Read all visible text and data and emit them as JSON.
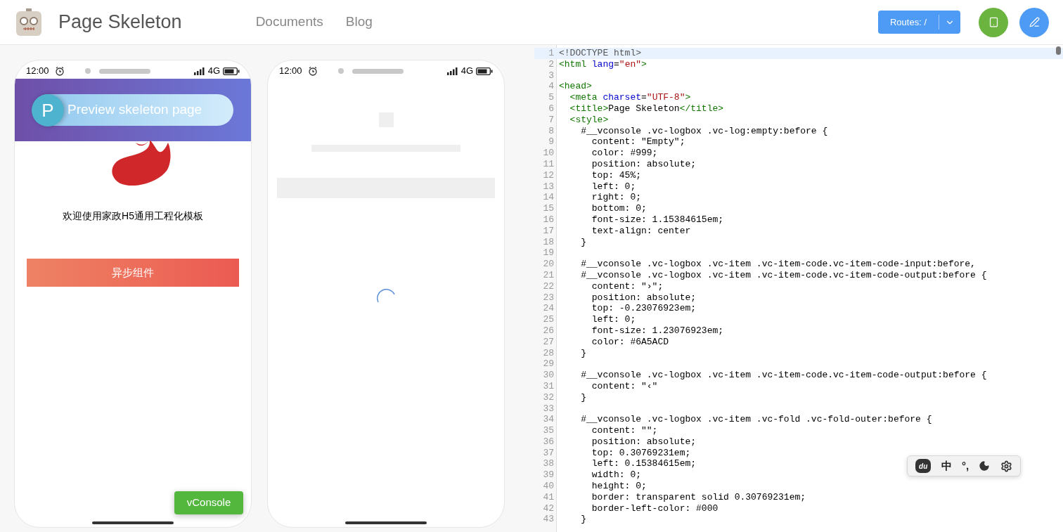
{
  "header": {
    "title": "Page Skeleton",
    "nav": [
      {
        "label": "Documents"
      },
      {
        "label": "Blog"
      }
    ],
    "routes_button": "Routes: /"
  },
  "phones": [
    {
      "kind": "app",
      "time": "12:00",
      "network": "4G",
      "banner_badge": "P",
      "banner_button": "Preview skeleton page",
      "welcome": "欢迎使用家政H5通用工程化模板",
      "action_button": "异步组件",
      "console_button": "vConsole"
    },
    {
      "kind": "skeleton",
      "time": "12:00",
      "network": "4G"
    }
  ],
  "editor": {
    "lines": [
      {
        "number": "1",
        "selected": true,
        "tokens": [
          {
            "kind": "meta",
            "text": "<!DOCTYPE html>"
          }
        ]
      },
      {
        "number": "2",
        "selected": false,
        "tokens": [
          {
            "kind": "tag",
            "text": "<html"
          },
          {
            "kind": "attr",
            "text": " lang"
          },
          {
            "kind": "text",
            "text": "="
          },
          {
            "kind": "string",
            "text": "\"en\""
          },
          {
            "kind": "tag",
            "text": ">"
          }
        ]
      },
      {
        "number": "3",
        "selected": false
      },
      {
        "number": "4",
        "selected": false,
        "tokens": [
          {
            "kind": "tag",
            "text": "<head>"
          }
        ]
      },
      {
        "number": "5",
        "selected": false,
        "tokens": [
          {
            "kind": "tag",
            "text": "  <meta"
          },
          {
            "kind": "attr",
            "text": " charset"
          },
          {
            "kind": "text",
            "text": "="
          },
          {
            "kind": "string",
            "text": "\"UTF-8\""
          },
          {
            "kind": "tag",
            "text": ">"
          }
        ]
      },
      {
        "number": "6",
        "selected": false,
        "tokens": [
          {
            "kind": "tag",
            "text": "  <title>"
          },
          {
            "kind": "text",
            "text": "Page Skeleton"
          },
          {
            "kind": "tag",
            "text": "</title>"
          }
        ]
      },
      {
        "number": "7",
        "selected": false,
        "tokens": [
          {
            "kind": "tag",
            "text": "  <style>"
          }
        ]
      },
      {
        "number": "8",
        "selected": false,
        "tokens": [
          {
            "kind": "text",
            "text": "    #__vconsole .vc-logbox .vc-log:empty:before {"
          }
        ]
      },
      {
        "number": "9",
        "selected": false,
        "tokens": [
          {
            "kind": "text",
            "text": "      content: \"Empty\";"
          }
        ]
      },
      {
        "number": "10",
        "selected": false,
        "tokens": [
          {
            "kind": "text",
            "text": "      color: #999;"
          }
        ]
      },
      {
        "number": "11",
        "selected": false,
        "tokens": [
          {
            "kind": "text",
            "text": "      position: absolute;"
          }
        ]
      },
      {
        "number": "12",
        "selected": false,
        "tokens": [
          {
            "kind": "text",
            "text": "      top: 45%;"
          }
        ]
      },
      {
        "number": "13",
        "selected": false,
        "tokens": [
          {
            "kind": "text",
            "text": "      left: 0;"
          }
        ]
      },
      {
        "number": "14",
        "selected": false,
        "tokens": [
          {
            "kind": "text",
            "text": "      right: 0;"
          }
        ]
      },
      {
        "number": "15",
        "selected": false,
        "tokens": [
          {
            "kind": "text",
            "text": "      bottom: 0;"
          }
        ]
      },
      {
        "number": "16",
        "selected": false,
        "tokens": [
          {
            "kind": "text",
            "text": "      font-size: 1.15384615em;"
          }
        ]
      },
      {
        "number": "17",
        "selected": false,
        "tokens": [
          {
            "kind": "text",
            "text": "      text-align: center"
          }
        ]
      },
      {
        "number": "18",
        "selected": false,
        "tokens": [
          {
            "kind": "text",
            "text": "    }"
          }
        ]
      },
      {
        "number": "19",
        "selected": false
      },
      {
        "number": "20",
        "selected": false,
        "tokens": [
          {
            "kind": "text",
            "text": "    #__vconsole .vc-logbox .vc-item .vc-item-code.vc-item-code-input:before,"
          }
        ]
      },
      {
        "number": "21",
        "selected": false,
        "tokens": [
          {
            "kind": "text",
            "text": "    #__vconsole .vc-logbox .vc-item .vc-item-code.vc-item-code-output:before {"
          }
        ]
      },
      {
        "number": "22",
        "selected": false,
        "tokens": [
          {
            "kind": "text",
            "text": "      content: \"›\";"
          }
        ]
      },
      {
        "number": "23",
        "selected": false,
        "tokens": [
          {
            "kind": "text",
            "text": "      position: absolute;"
          }
        ]
      },
      {
        "number": "24",
        "selected": false,
        "tokens": [
          {
            "kind": "text",
            "text": "      top: -0.23076923em;"
          }
        ]
      },
      {
        "number": "25",
        "selected": false,
        "tokens": [
          {
            "kind": "text",
            "text": "      left: 0;"
          }
        ]
      },
      {
        "number": "26",
        "selected": false,
        "tokens": [
          {
            "kind": "text",
            "text": "      font-size: 1.23076923em;"
          }
        ]
      },
      {
        "number": "27",
        "selected": false,
        "tokens": [
          {
            "kind": "text",
            "text": "      color: #6A5ACD"
          }
        ]
      },
      {
        "number": "28",
        "selected": false,
        "tokens": [
          {
            "kind": "text",
            "text": "    }"
          }
        ]
      },
      {
        "number": "29",
        "selected": false
      },
      {
        "number": "30",
        "selected": false,
        "tokens": [
          {
            "kind": "text",
            "text": "    #__vconsole .vc-logbox .vc-item .vc-item-code.vc-item-code-output:before {"
          }
        ]
      },
      {
        "number": "31",
        "selected": false,
        "tokens": [
          {
            "kind": "text",
            "text": "      content: \"‹\""
          }
        ]
      },
      {
        "number": "32",
        "selected": false,
        "tokens": [
          {
            "kind": "text",
            "text": "    }"
          }
        ]
      },
      {
        "number": "33",
        "selected": false
      },
      {
        "number": "34",
        "selected": false,
        "tokens": [
          {
            "kind": "text",
            "text": "    #__vconsole .vc-logbox .vc-item .vc-fold .vc-fold-outer:before {"
          }
        ]
      },
      {
        "number": "35",
        "selected": false,
        "tokens": [
          {
            "kind": "text",
            "text": "      content: \"\";"
          }
        ]
      },
      {
        "number": "36",
        "selected": false,
        "tokens": [
          {
            "kind": "text",
            "text": "      position: absolute;"
          }
        ]
      },
      {
        "number": "37",
        "selected": false,
        "tokens": [
          {
            "kind": "text",
            "text": "      top: 0.30769231em;"
          }
        ]
      },
      {
        "number": "38",
        "selected": false,
        "tokens": [
          {
            "kind": "text",
            "text": "      left: 0.15384615em;"
          }
        ]
      },
      {
        "number": "39",
        "selected": false,
        "tokens": [
          {
            "kind": "text",
            "text": "      width: 0;"
          }
        ]
      },
      {
        "number": "40",
        "selected": false,
        "tokens": [
          {
            "kind": "text",
            "text": "      height: 0;"
          }
        ]
      },
      {
        "number": "41",
        "selected": false,
        "tokens": [
          {
            "kind": "text",
            "text": "      border: transparent solid 0.30769231em;"
          }
        ]
      },
      {
        "number": "42",
        "selected": false,
        "tokens": [
          {
            "kind": "text",
            "text": "      border-left-color: #000"
          }
        ]
      },
      {
        "number": "43",
        "selected": false,
        "tokens": [
          {
            "kind": "text",
            "text": "    }"
          }
        ]
      }
    ]
  },
  "ime_toolbar": {
    "items": [
      {
        "kind": "logo",
        "text": "du"
      },
      {
        "kind": "text",
        "text": "中"
      },
      {
        "kind": "text",
        "text": "°,"
      },
      {
        "kind": "moon"
      },
      {
        "kind": "gear"
      }
    ]
  }
}
